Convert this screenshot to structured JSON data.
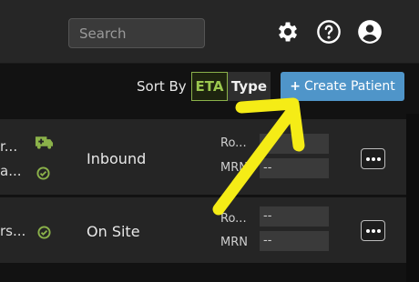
{
  "header": {
    "search_placeholder": "Search",
    "icons": [
      "gear-icon",
      "help-icon",
      "account-icon"
    ]
  },
  "sort": {
    "label": "Sort By",
    "options": [
      "ETA",
      "Type"
    ],
    "selected": "ETA"
  },
  "create_button": {
    "plus": "+",
    "label": "Create Patient"
  },
  "colors": {
    "accent_blue": "#4f95c9",
    "accent_green": "#8bb24a",
    "annotation_yellow": "#f5ec16"
  },
  "rows": [
    {
      "line1": "r...",
      "line2": "a...",
      "status_icons": [
        "ambulance-icon",
        "check-circle-icon"
      ],
      "status": "Inbound",
      "field1_label": "Ro...",
      "field1_value": "--",
      "field2_label": "MRN",
      "field2_value": "--"
    },
    {
      "line1": "rs...",
      "status_icons": [
        "check-circle-icon"
      ],
      "status": "On Site",
      "field1_label": "Ro...",
      "field1_value": "--",
      "field2_label": "MRN",
      "field2_value": "--"
    }
  ]
}
